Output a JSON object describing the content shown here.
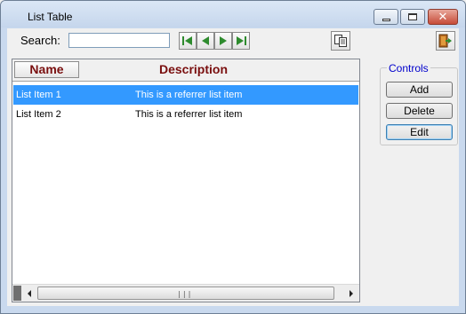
{
  "window": {
    "title": "List Table"
  },
  "toolbar": {
    "search_label": "Search:",
    "search_value": ""
  },
  "list": {
    "columns": [
      "Name",
      "Description"
    ],
    "rows": [
      {
        "name": "List Item 1",
        "description": "This is a referrer list item",
        "selected": true
      },
      {
        "name": "List Item 2",
        "description": "This is a referrer list item",
        "selected": false
      }
    ]
  },
  "controls": {
    "legend": "Controls",
    "add_label": "Add",
    "delete_label": "Delete",
    "edit_label": "Edit"
  },
  "colors": {
    "header_text": "#7a0f0f",
    "selection": "#3399ff",
    "legend_text": "#0000cc",
    "nav_green": "#2e8b2e"
  },
  "icons": [
    "first-record-icon",
    "previous-record-icon",
    "next-record-icon",
    "last-record-icon",
    "copy-icon",
    "exit-icon",
    "minimize-icon",
    "maximize-icon",
    "close-icon"
  ]
}
